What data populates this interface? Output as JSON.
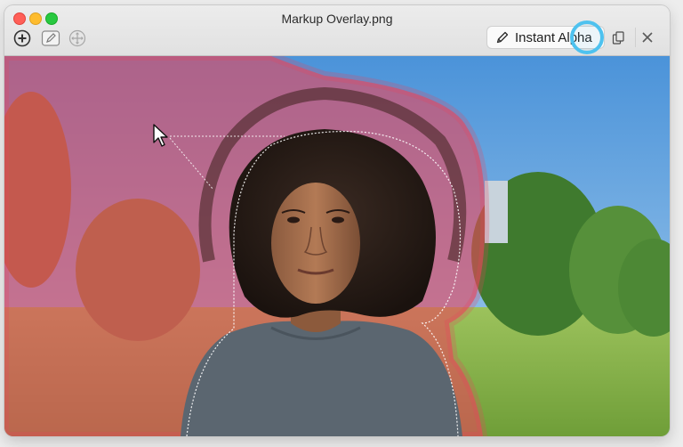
{
  "window": {
    "title": "Markup Overlay.png"
  },
  "toolbar": {
    "add_icon": "plus-circle-icon",
    "edit_icon": "pencil-square-icon",
    "move_icon": "move-crosshair-icon",
    "instant_alpha_label": "Instant Alpha",
    "instant_alpha_icon": "pencil-icon",
    "share_icon": "share-icon",
    "close_icon": "close-icon"
  },
  "canvas": {
    "overlay_color": "#e8455a",
    "selection_color": "#ffffff"
  }
}
